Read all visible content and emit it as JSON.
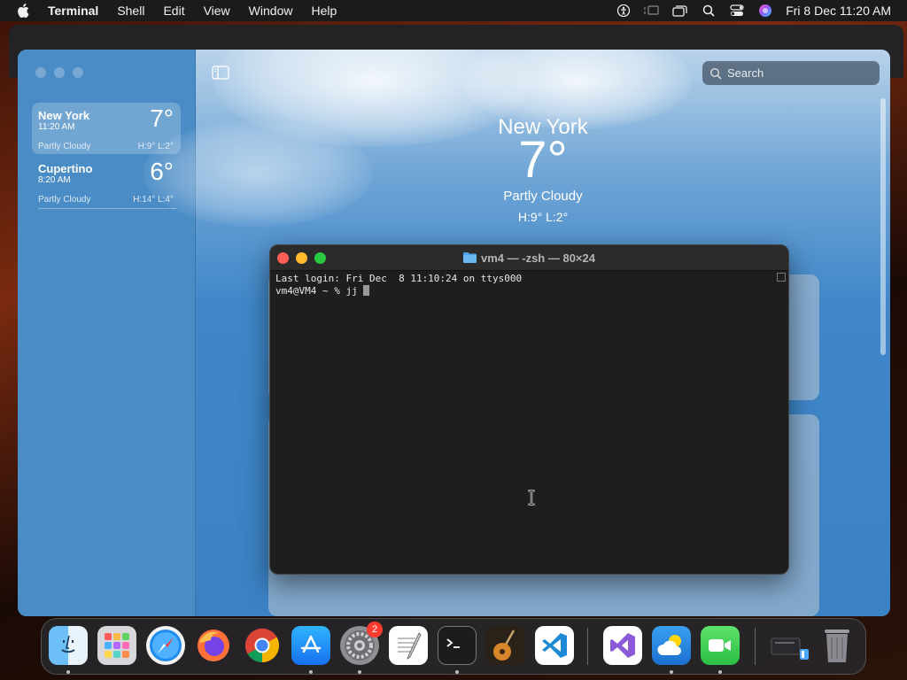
{
  "menubar": {
    "app_name": "Terminal",
    "items": [
      "Shell",
      "Edit",
      "View",
      "Window",
      "Help"
    ],
    "clock": "Fri 8 Dec  11:20 AM"
  },
  "weather": {
    "search_placeholder": "Search",
    "cities": [
      {
        "name": "New York",
        "time": "11:20 AM",
        "temp": "7°",
        "condition": "Partly Cloudy",
        "hilo": "H:9°  L:2°",
        "selected": true
      },
      {
        "name": "Cupertino",
        "time": "8:20 AM",
        "temp": "6°",
        "condition": "Partly Cloudy",
        "hilo": "H:14°  L:4°",
        "selected": false
      }
    ],
    "current": {
      "city": "New York",
      "temp": "7°",
      "condition": "Partly Cloudy",
      "hilo": "H:9°  L:2°"
    }
  },
  "terminal": {
    "title": "vm4 — -zsh — 80×24",
    "lines": [
      "Last login: Fri Dec  8 11:10:24 on ttys000",
      "vm4@VM4 ~ % jj "
    ]
  },
  "dock": {
    "items": [
      {
        "name": "finder",
        "running": true
      },
      {
        "name": "launchpad",
        "running": false
      },
      {
        "name": "safari",
        "running": false
      },
      {
        "name": "firefox",
        "running": false
      },
      {
        "name": "chrome",
        "running": false
      },
      {
        "name": "app-store",
        "running": true
      },
      {
        "name": "system-settings",
        "running": true,
        "badge": "2"
      },
      {
        "name": "textedit",
        "running": false
      },
      {
        "name": "terminal",
        "running": true
      },
      {
        "name": "garageband",
        "running": false
      },
      {
        "name": "vscode",
        "running": false
      },
      {
        "name": "visual-studio",
        "running": false
      },
      {
        "name": "weather",
        "running": true
      },
      {
        "name": "facetime",
        "running": true
      },
      {
        "name": "downloads",
        "running": false
      },
      {
        "name": "trash",
        "running": false
      }
    ]
  }
}
